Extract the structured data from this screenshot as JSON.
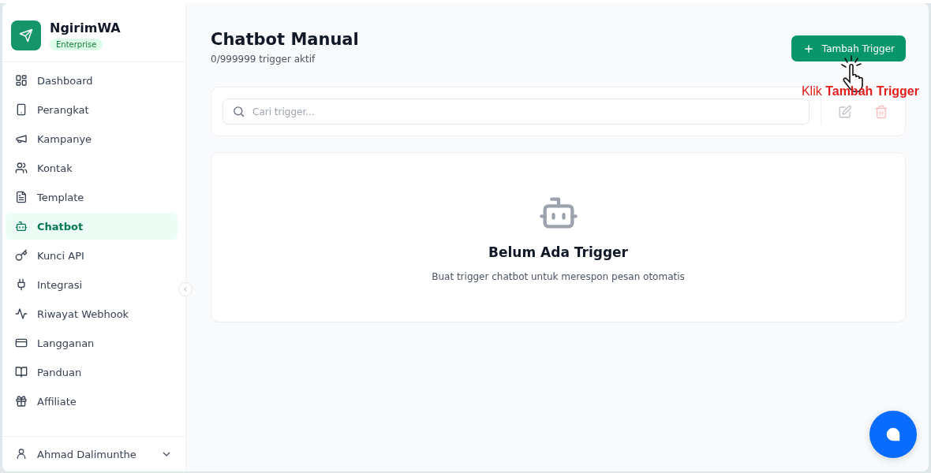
{
  "brand": {
    "name": "NgirimWA",
    "plan": "Enterprise"
  },
  "sidebar": {
    "items": [
      {
        "label": "Dashboard",
        "selected": false
      },
      {
        "label": "Perangkat",
        "selected": false
      },
      {
        "label": "Kampanye",
        "selected": false
      },
      {
        "label": "Kontak",
        "selected": false
      },
      {
        "label": "Template",
        "selected": false
      },
      {
        "label": "Chatbot",
        "selected": true
      },
      {
        "label": "Kunci API",
        "selected": false
      },
      {
        "label": "Integrasi",
        "selected": false
      },
      {
        "label": "Riwayat Webhook",
        "selected": false
      },
      {
        "label": "Langganan",
        "selected": false
      },
      {
        "label": "Panduan",
        "selected": false
      },
      {
        "label": "Affiliate",
        "selected": false
      }
    ],
    "user": "Ahmad Dalimunthe"
  },
  "page": {
    "title": "Chatbot Manual",
    "subtitle": "0/999999 trigger aktif",
    "add_button": "Tambah Trigger"
  },
  "search": {
    "placeholder": "Cari trigger...",
    "actions": [
      {
        "kind": "edit",
        "disabled": true
      },
      {
        "kind": "delete",
        "disabled": true
      }
    ]
  },
  "empty_state": {
    "title": "Belum Ada Trigger",
    "message": "Buat trigger chatbot untuk merespon pesan otomatis"
  },
  "annotation": "Klik **Tambah Trigger**"
}
